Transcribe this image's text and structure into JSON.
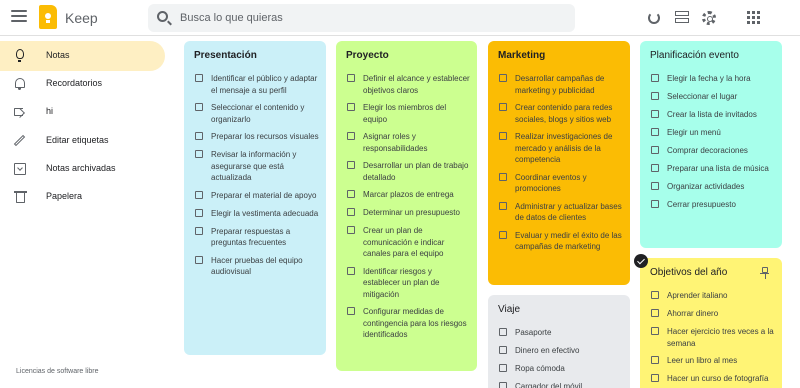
{
  "header": {
    "app_title": "Keep",
    "search_placeholder": "Busca lo que quieras"
  },
  "sidebar": {
    "items": [
      {
        "label": "Notas",
        "icon": "lightbulb-icon",
        "active": true
      },
      {
        "label": "Recordatorios",
        "icon": "bell-icon"
      },
      {
        "label": "hi",
        "icon": "label-icon"
      },
      {
        "label": "Editar etiquetas",
        "icon": "pencil-icon"
      },
      {
        "label": "Notas archivadas",
        "icon": "archive-icon"
      },
      {
        "label": "Papelera",
        "icon": "trash-icon"
      }
    ],
    "footer_link": "Licencias de software libre"
  },
  "notes": [
    {
      "title": "Presentación",
      "color": "#cbf0f8",
      "items": [
        "Identificar el público y adaptar el mensaje a su perfil",
        "Seleccionar el contenido y organizarlo",
        "Preparar los recursos visuales",
        "Revisar la información y asegurarse que está actualizada",
        "Preparar el material de apoyo",
        "Elegir la vestimenta adecuada",
        "Preparar respuestas a preguntas frecuentes",
        "Hacer pruebas del equipo audiovisual"
      ]
    },
    {
      "title": "Proyecto",
      "color": "#ccff90",
      "items": [
        "Definir el alcance y establecer objetivos claros",
        "Elegir los miembros del equipo",
        "Asignar roles y responsabilidades",
        "Desarrollar un plan de trabajo detallado",
        "Marcar plazos de entrega",
        "Determinar un presupuesto",
        "Crear un plan de comunicación e indicar canales para el equipo",
        "Identificar riesgos y establecer un plan de mitigación",
        "Configurar medidas de contingencia para los riesgos identificados"
      ]
    },
    {
      "title": "Marketing",
      "color": "#fbbc04",
      "items": [
        "Desarrollar campañas de marketing y publicidad",
        "Crear contenido para redes sociales, blogs y sitios web",
        "Realizar investigaciones de mercado y análisis de la competencia",
        "Coordinar eventos y promociones",
        "Administrar y actualizar bases de datos de clientes",
        "Evaluar y medir el éxito de las campañas de marketing"
      ]
    },
    {
      "title": "Viaje",
      "color": "#e8eaed",
      "items": [
        "Pasaporte",
        "Dinero en efectivo",
        "Ropa cómoda",
        "Cargador del móvil"
      ]
    },
    {
      "title": "Planificación evento",
      "color": "#a7ffeb",
      "items": [
        "Elegir la fecha y la hora",
        "Seleccionar el lugar",
        "Crear la lista de invitados",
        "Elegir un menú",
        "Comprar decoraciones",
        "Preparar una lista de música",
        "Organizar actividades",
        "Cerrar presupuesto"
      ]
    },
    {
      "title": "Objetivos del año",
      "color": "#fff475",
      "pinned": true,
      "items": [
        "Aprender italiano",
        "Ahorrar dinero",
        "Hacer ejercicio tres veces a la semana",
        "Leer un libro al mes",
        "Hacer un curso de fotografía"
      ]
    }
  ]
}
